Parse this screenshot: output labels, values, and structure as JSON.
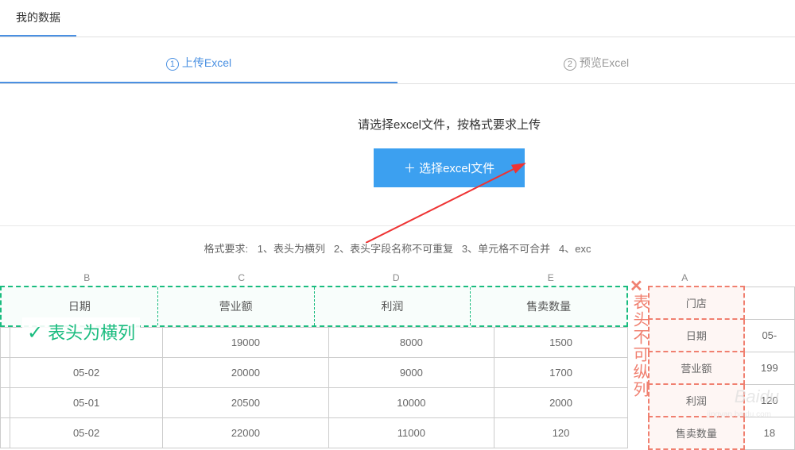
{
  "header": {
    "tab_mydata": "我的数据"
  },
  "steps": {
    "step1_num": "1",
    "step1_label": "上传Excel",
    "step2_num": "2",
    "step2_label": "预览Excel"
  },
  "upload": {
    "instruction": "请选择excel文件，按格式要求上传",
    "button_plus": "＋",
    "button_label": "选择excel文件"
  },
  "format": {
    "label": "格式要求:",
    "rule1": "1、表头为横列",
    "rule2": "2、表头字段名称不可重复",
    "rule3": "3、单元格不可合并",
    "rule4": "4、exc"
  },
  "left_table": {
    "cols": [
      "B",
      "C",
      "D",
      "E"
    ],
    "headers": [
      "日期",
      "营业额",
      "利润",
      "售卖数量"
    ],
    "rows": [
      [
        "",
        "19000",
        "8000",
        "1500"
      ],
      [
        "05-02",
        "20000",
        "9000",
        "1700"
      ],
      [
        "05-01",
        "20500",
        "10000",
        "2000"
      ],
      [
        "05-02",
        "22000",
        "11000",
        "120"
      ]
    ],
    "good_label": "表头为横列"
  },
  "right_table": {
    "cols": [
      "A",
      ""
    ],
    "headers": [
      "门店",
      ""
    ],
    "rows": [
      [
        "日期",
        "05-"
      ],
      [
        "营业额",
        "199"
      ],
      [
        "利润",
        "120"
      ],
      [
        "售卖数量",
        "18"
      ]
    ],
    "bad_label": "表头不可纵列"
  },
  "watermark": {
    "main": "Baidu",
    "sub": "jingyan.baidu.com"
  }
}
